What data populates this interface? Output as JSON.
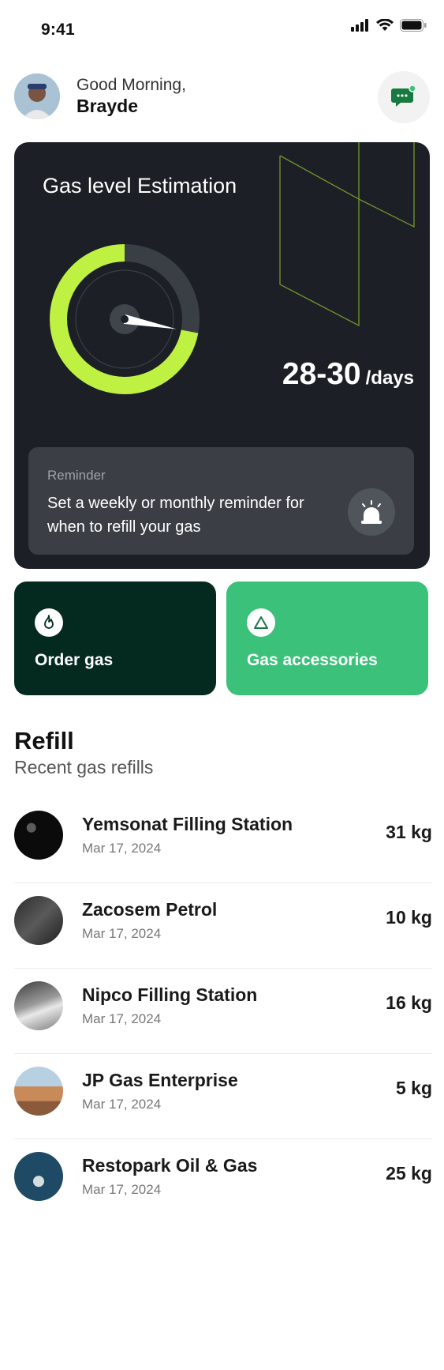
{
  "status_bar": {
    "time": "9:41"
  },
  "header": {
    "greeting": "Good Morning,",
    "user_name": "Brayde"
  },
  "gas_card": {
    "title": "Gas level Estimation",
    "gauge_level_percent": 72,
    "days_value": "28-30",
    "days_unit": "/days",
    "accent_color": "#bef141",
    "reminder": {
      "label": "Reminder",
      "text": "Set a weekly or monthly reminder for when to refill your gas"
    }
  },
  "actions": {
    "order_gas": "Order gas",
    "gas_accessories": "Gas accessories"
  },
  "refill": {
    "title": "Refill",
    "subtitle": "Recent gas refills",
    "items": [
      {
        "name": "Yemsonat Filling Station",
        "date": "Mar 17, 2024",
        "qty": "31 kg"
      },
      {
        "name": "Zacosem Petrol",
        "date": "Mar 17, 2024",
        "qty": "10 kg"
      },
      {
        "name": "Nipco Filling Station",
        "date": "Mar 17, 2024",
        "qty": "16 kg"
      },
      {
        "name": "JP Gas Enterprise",
        "date": "Mar 17, 2024",
        "qty": "5 kg"
      },
      {
        "name": "Restopark Oil & Gas",
        "date": "Mar 17, 2024",
        "qty": "25 kg"
      }
    ]
  }
}
